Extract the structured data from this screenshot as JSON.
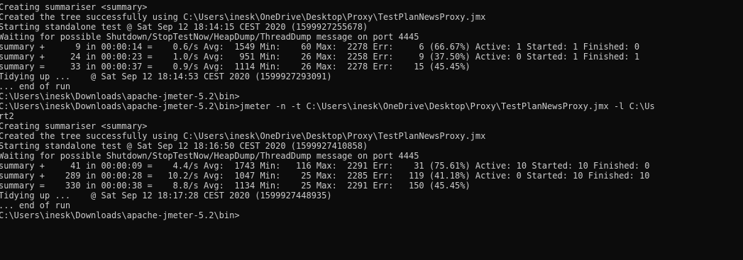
{
  "terminal": {
    "background": "#0c0c0c",
    "foreground": "#cccccc",
    "lines": [
      "Creating summariser <summary>",
      "Created the tree successfully using C:\\Users\\inesk\\OneDrive\\Desktop\\Proxy\\TestPlanNewsProxy.jmx",
      "Starting standalone test @ Sat Sep 12 18:14:15 CEST 2020 (1599927255678)",
      "Waiting for possible Shutdown/StopTestNow/HeapDump/ThreadDump message on port 4445",
      "summary +      9 in 00:00:14 =    0.6/s Avg:  1549 Min:    60 Max:  2278 Err:     6 (66.67%) Active: 1 Started: 1 Finished: 0",
      "summary +     24 in 00:00:23 =    1.0/s Avg:   951 Min:    26 Max:  2258 Err:     9 (37.50%) Active: 0 Started: 1 Finished: 1",
      "summary =     33 in 00:00:37 =    0.9/s Avg:  1114 Min:    26 Max:  2278 Err:    15 (45.45%)",
      "Tidying up ...    @ Sat Sep 12 18:14:53 CEST 2020 (1599927293091)",
      "... end of run",
      "C:\\Users\\inesk\\Downloads\\apache-jmeter-5.2\\bin>",
      "C:\\Users\\inesk\\Downloads\\apache-jmeter-5.2\\bin>jmeter -n -t C:\\Users\\inesk\\OneDrive\\Desktop\\Proxy\\TestPlanNewsProxy.jmx -l C:\\Us",
      "rt2",
      "Creating summariser <summary>",
      "Created the tree successfully using C:\\Users\\inesk\\OneDrive\\Desktop\\Proxy\\TestPlanNewsProxy.jmx",
      "Starting standalone test @ Sat Sep 12 18:16:50 CEST 2020 (1599927410858)",
      "Waiting for possible Shutdown/StopTestNow/HeapDump/ThreadDump message on port 4445",
      "summary +     41 in 00:00:09 =    4.4/s Avg:  1743 Min:   116 Max:  2291 Err:    31 (75.61%) Active: 10 Started: 10 Finished: 0",
      "summary +    289 in 00:00:28 =   10.2/s Avg:  1047 Min:    25 Max:  2285 Err:   119 (41.18%) Active: 0 Started: 10 Finished: 10",
      "summary =    330 in 00:00:38 =    8.8/s Avg:  1134 Min:    25 Max:  2291 Err:   150 (45.45%)",
      "Tidying up ...    @ Sat Sep 12 18:17:28 CEST 2020 (1599927448935)",
      "... end of run",
      "C:\\Users\\inesk\\Downloads\\apache-jmeter-5.2\\bin>"
    ]
  }
}
